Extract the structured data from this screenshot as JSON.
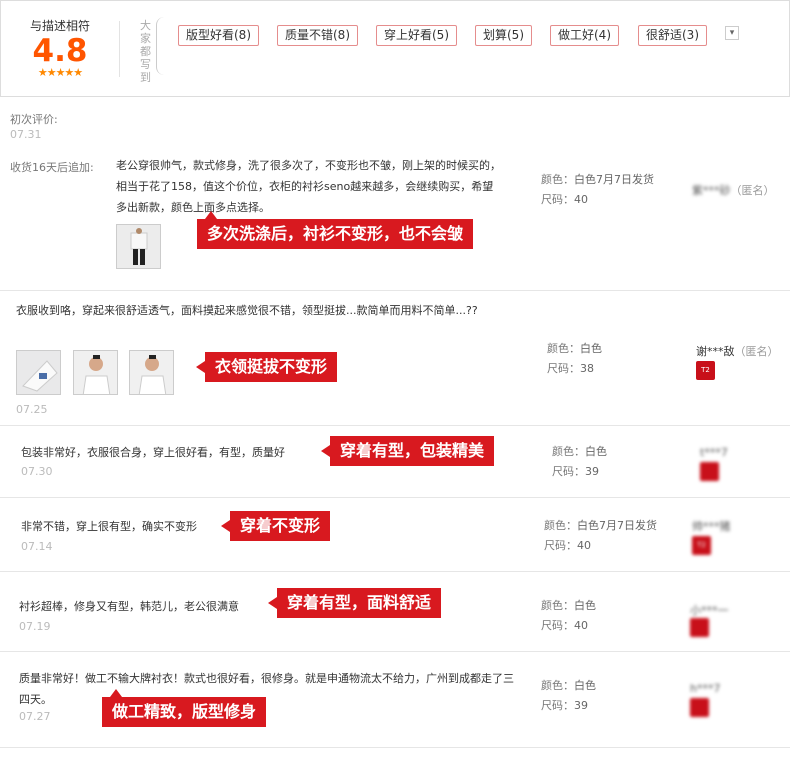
{
  "rating": {
    "label": "与描述相符",
    "score": "4.8",
    "stars": "★★★★★",
    "everyone_says": "大家都写到",
    "tags": [
      "版型好看(8)",
      "质量不错(8)",
      "穿上好看(5)",
      "划算(5)",
      "做工好(4)",
      "很舒适(3)"
    ],
    "more_icon": "chevron-down-icon"
  },
  "reviews": [
    {
      "first_label": "初次评价:",
      "first_date": "07.31",
      "append_label": "收货16天后追加:",
      "text": "老公穿很帅气，款式修身，洗了很多次了，不变形也不皱，刚上架的时候买的，相当于花了158，值这个价位，衣柜的衬衫seno越来越多，会继续购买，希望多出新款，颜色上面多点选择。",
      "callout": "多次洗涤后，衬衫不变形，也不会皱",
      "color_label": "颜色：",
      "color": "白色7月7日发货",
      "size_label": "尺码：",
      "size": "40",
      "user": "紫***砂",
      "anon": "（匿名）"
    },
    {
      "text": "衣服收到咯，穿起来很舒适透气，面料摸起来感觉很不错，领型挺拔...款简单而用料不简单...??",
      "callout": "衣领挺拔不变形",
      "date": "07.25",
      "color_label": "颜色：",
      "color": "白色",
      "size_label": "尺码：",
      "size": "38",
      "user": "谢***敌",
      "anon": "（匿名）",
      "badge": "T2"
    },
    {
      "text": "包装非常好，衣服很合身，穿上很好看，有型，质量好",
      "callout": "穿着有型，包装精美",
      "date": "07.30",
      "color_label": "颜色：",
      "color": "白色",
      "size_label": "尺码：",
      "size": "39",
      "user": "t***7"
    },
    {
      "text": "非常不错，穿上很有型，确实不变形",
      "callout": "穿着不变形",
      "date": "07.14",
      "color_label": "颜色：",
      "color": "白色7月7日发货",
      "size_label": "尺码：",
      "size": "40",
      "user": "帅***猪",
      "badge": "T2"
    },
    {
      "text": "衬衫超棒，修身又有型，韩范儿，老公很满意",
      "callout": "穿着有型，面料舒适",
      "date": "07.19",
      "color_label": "颜色：",
      "color": "白色",
      "size_label": "尺码：",
      "size": "40",
      "user": "小***一"
    },
    {
      "text": "质量非常好！做工不输大牌衬衣！款式也很好看，很修身。就是申通物流太不给力，广州到成都走了三四天。",
      "callout": "做工精致，版型修身",
      "date": "07.27",
      "color_label": "颜色：",
      "color": "白色",
      "size_label": "尺码：",
      "size": "39",
      "user": "h***7"
    }
  ]
}
